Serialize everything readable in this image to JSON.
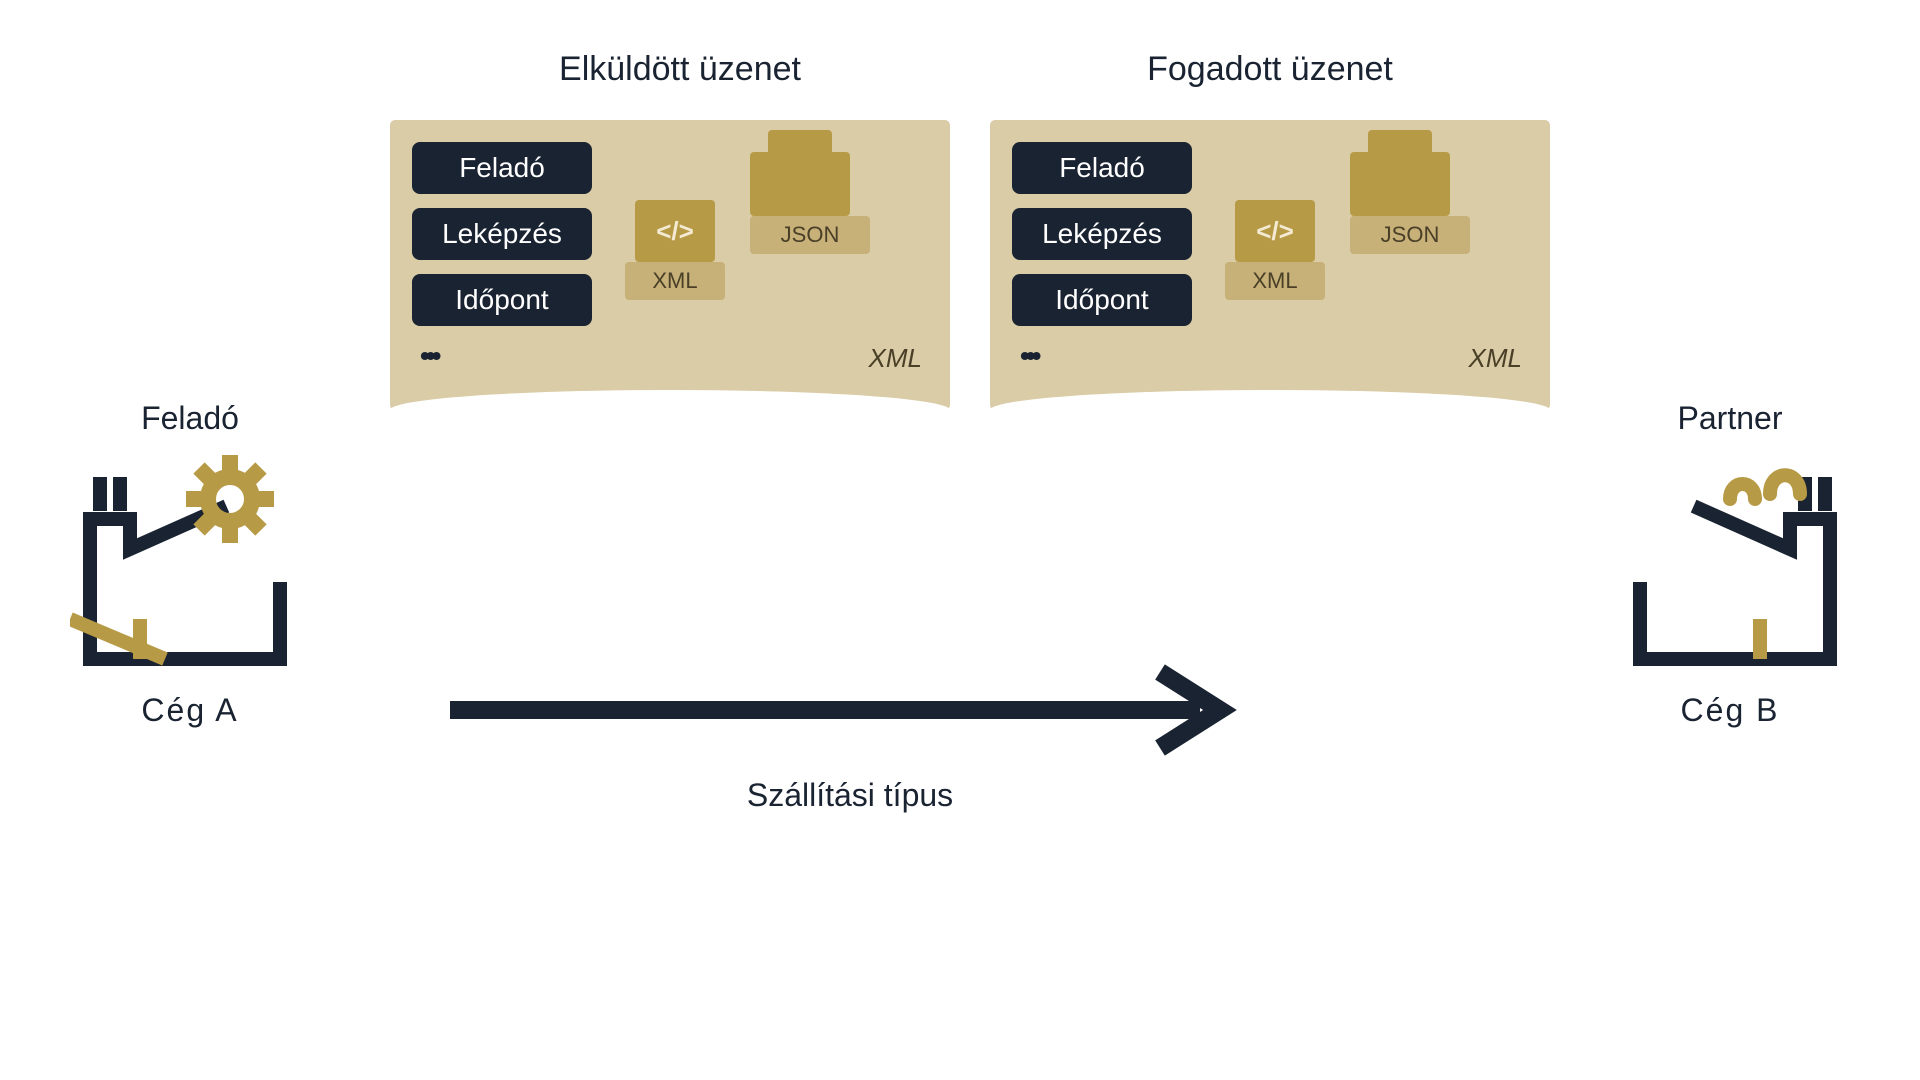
{
  "colors": {
    "dark": "#1a2332",
    "gold": "#b79a46",
    "goldLight": "#c7b178",
    "sand": "#d9cca6"
  },
  "sent": {
    "heading": "Elküldött üzenet",
    "chips": [
      "Feladó",
      "Leképzés",
      "Időpont"
    ],
    "codeGlyph": "</>",
    "xmlLabel": "XML",
    "jsonLabel": "JSON",
    "formatLabel": "XML"
  },
  "received": {
    "heading": "Fogadott üzenet",
    "chips": [
      "Feladó",
      "Leképzés",
      "Időpont"
    ],
    "codeGlyph": "</>",
    "xmlLabel": "XML",
    "jsonLabel": "JSON",
    "formatLabel": "XML"
  },
  "leftCompany": {
    "role": "Feladó",
    "name": "Cég  A"
  },
  "rightCompany": {
    "role": "Partner",
    "name": "Cég  B"
  },
  "transport": {
    "label": "Szállítási típus"
  }
}
